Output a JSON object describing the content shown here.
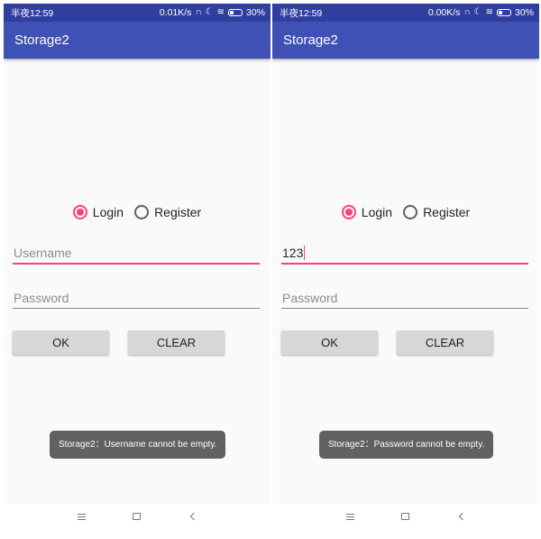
{
  "screens": [
    {
      "status": {
        "time": "半夜12:59",
        "speed": "0.01K/s",
        "battery": "30%",
        "battery_level": 0.3
      },
      "app_title": "Storage2",
      "mode": {
        "login_label": "Login",
        "register_label": "Register",
        "selected": "Login"
      },
      "username": {
        "value": "",
        "placeholder": "Username",
        "focused": true
      },
      "password": {
        "value": "",
        "placeholder": "Password"
      },
      "buttons": {
        "ok": "OK",
        "clear": "CLEAR"
      },
      "toast": "Storage2：Username cannot be empty."
    },
    {
      "status": {
        "time": "半夜12:59",
        "speed": "0.00K/s",
        "battery": "30%",
        "battery_level": 0.3
      },
      "app_title": "Storage2",
      "mode": {
        "login_label": "Login",
        "register_label": "Register",
        "selected": "Login"
      },
      "username": {
        "value": "123",
        "placeholder": "Username",
        "focused": true
      },
      "password": {
        "value": "",
        "placeholder": "Password"
      },
      "buttons": {
        "ok": "OK",
        "clear": "CLEAR"
      },
      "toast": "Storage2：Password cannot be empty."
    }
  ],
  "icons": {
    "status": [
      "headphones-icon",
      "alarm-icon",
      "moon-icon",
      "wifi-icon",
      "battery-icon"
    ],
    "nav": [
      "menu-icon",
      "home-icon",
      "back-icon"
    ]
  },
  "colors": {
    "status_bar": "#303f9f",
    "app_bar": "#3f51b5",
    "accent": "#ff4081",
    "toast_bg": "#616161",
    "button_bg": "#d6d7d7"
  }
}
